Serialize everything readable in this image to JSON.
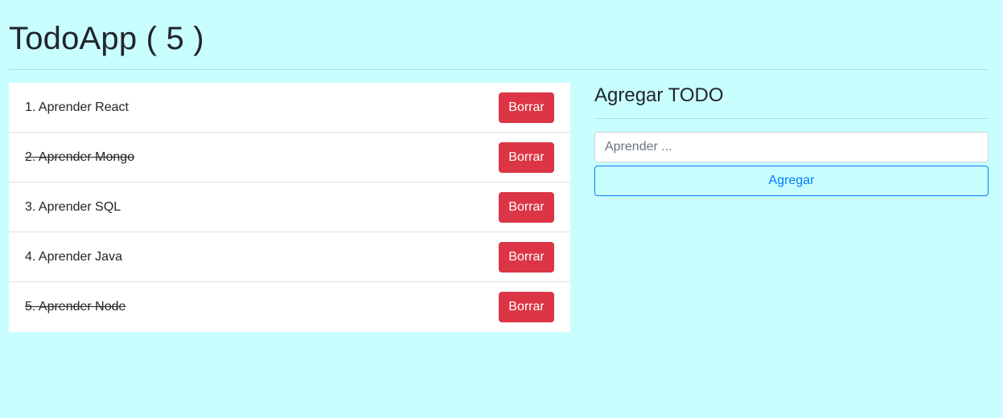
{
  "header": {
    "title": "TodoApp ( 5 )"
  },
  "todos": [
    {
      "text": "1. Aprender React",
      "completed": false,
      "delete_label": "Borrar"
    },
    {
      "text": "2. Aprender Mongo",
      "completed": true,
      "delete_label": "Borrar"
    },
    {
      "text": "3. Aprender SQL",
      "completed": false,
      "delete_label": "Borrar"
    },
    {
      "text": "4. Aprender Java",
      "completed": false,
      "delete_label": "Borrar"
    },
    {
      "text": "5. Aprender Node",
      "completed": true,
      "delete_label": "Borrar"
    }
  ],
  "form": {
    "title": "Agregar TODO",
    "input_value": "",
    "input_placeholder": "Aprender ...",
    "submit_label": "Agregar"
  },
  "colors": {
    "background": "#c9feff",
    "danger": "#dc3545",
    "primary": "#007bff"
  }
}
